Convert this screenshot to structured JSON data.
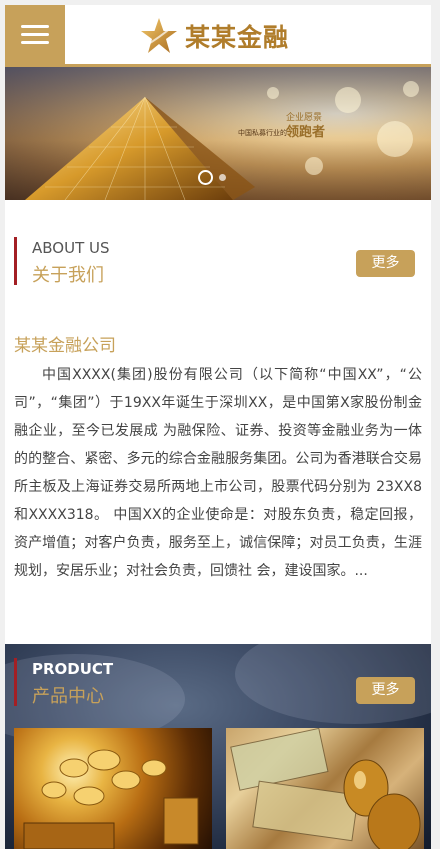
{
  "header": {
    "menu_icon": "hamburger-menu-icon",
    "logo_icon": "gold-star-icon",
    "logo_text": "某某金融",
    "accent_color": "#c7a15a"
  },
  "banner": {
    "slogan_small": "企业愿景",
    "slogan_mid": "中国私募行业的",
    "slogan_big": "领跑者",
    "active_slide": 1
  },
  "about": {
    "en_title": "ABOUT US",
    "cn_title": "关于我们",
    "more_label": "更多",
    "company_title": "某某金融公司",
    "description": "中国XXXX(集团)股份有限公司（以下简称“中国XX”，“公司”，“集团”）于19XX年诞生于深圳XX，是中国第X家股份制金融企业，至今已发展成 为融保险、证券、投资等金融业务为一体的的整合、紧密、多元的综合金融服务集团。公司为香港联合交易所主板及上海证券交易所两地上市公司，股票代码分别为 23XX8和XXXX318。 中国XX的企业使命是：对股东负责，稳定回报，资产增值；对客户负责，服务至上，诚信保障；对员工负责，生涯规划，安居乐业；对社会负责，回馈社 会，建设国家。..."
  },
  "products": {
    "en_title": "PRODUCT",
    "cn_title": "产品中心",
    "more_label": "更多"
  },
  "colors": {
    "accent": "#c7a15a",
    "section_bar": "#a31f24"
  }
}
